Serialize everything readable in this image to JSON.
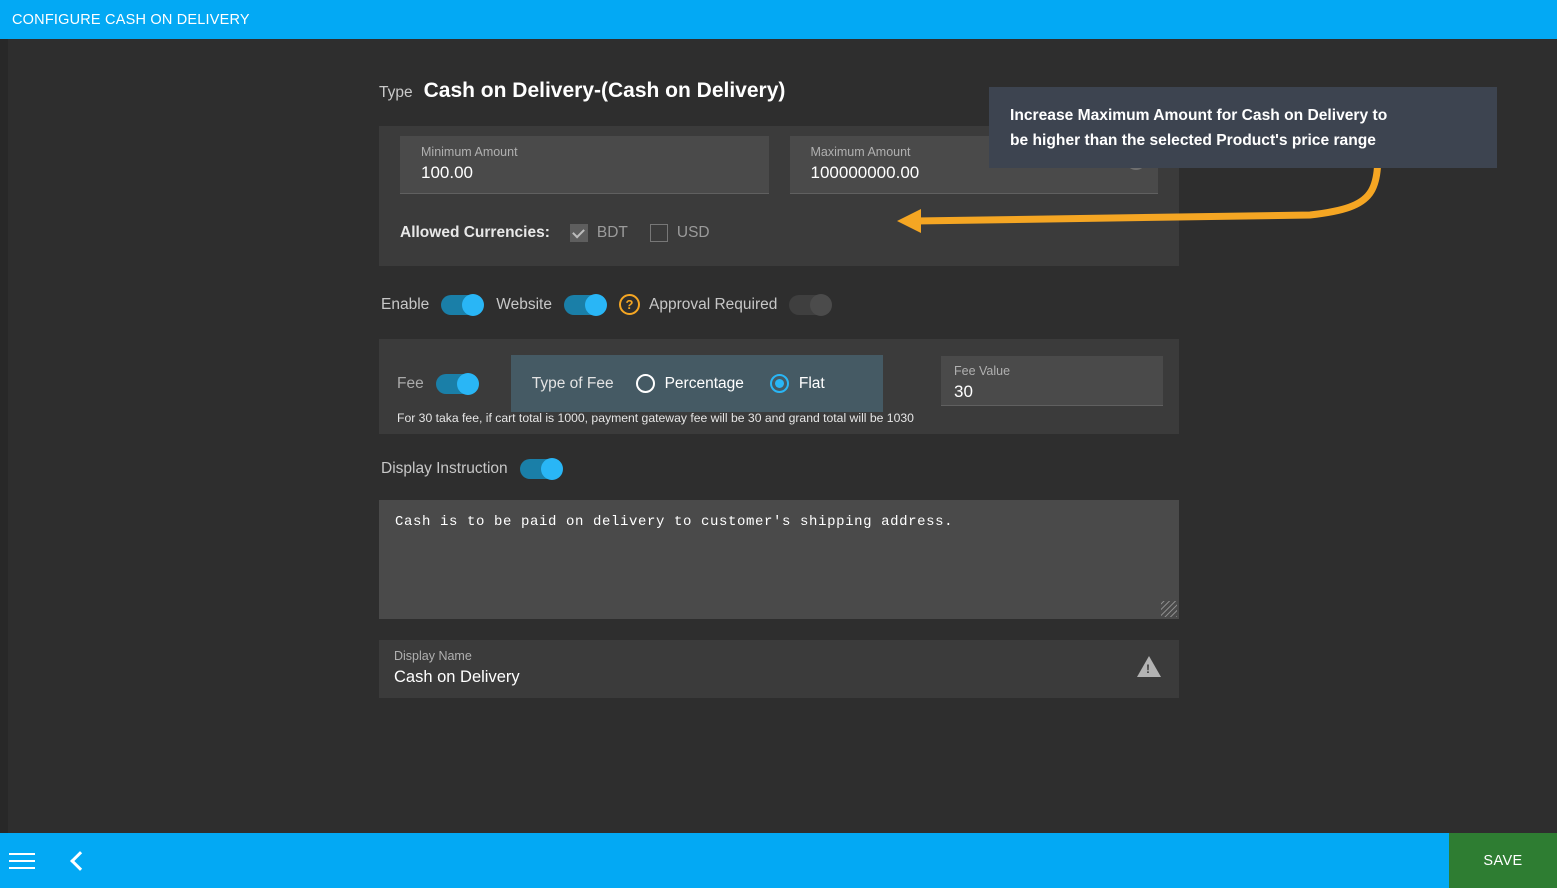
{
  "window": {
    "title": "CONFIGURE CASH ON DELIVERY"
  },
  "type_row": {
    "label": "Type",
    "value": "Cash on Delivery-(Cash on Delivery)"
  },
  "amounts": {
    "minimum": {
      "label": "Minimum Amount",
      "value": "100.00"
    },
    "maximum": {
      "label": "Maximum Amount",
      "value": "100000000.00",
      "info_icon": "info-icon"
    },
    "currencies": {
      "label": "Allowed Currencies:",
      "options": [
        {
          "code": "BDT",
          "checked": true
        },
        {
          "code": "USD",
          "checked": false
        }
      ]
    }
  },
  "toggles": [
    {
      "label": "Enable",
      "on": true
    },
    {
      "label": "Website",
      "on": true
    },
    {
      "label": "Approval Required",
      "on": false,
      "badge": "?"
    }
  ],
  "fee": {
    "label": "Fee",
    "enabled": true,
    "type_of_fee_label": "Type of Fee",
    "options": [
      {
        "label": "Percentage",
        "selected": false
      },
      {
        "label": "Flat",
        "selected": true
      }
    ],
    "value_label": "Fee Value",
    "value": "30",
    "hint": "For 30 taka fee, if cart total is 1000, payment gateway fee will be 30 and grand total will be 1030"
  },
  "instruction": {
    "toggle_label": "Display Instruction",
    "toggle_on": true,
    "text": "Cash is to be paid on delivery to customer's shipping address."
  },
  "display_name": {
    "label": "Display Name",
    "value": "Cash on Delivery",
    "warning_icon": "warning-triangle-icon"
  },
  "callout": {
    "line1": "Increase Maximum Amount for Cash on Delivery to",
    "line2": "be higher than the selected Product's price range",
    "arrow_color": "#F5A623",
    "background": "#3d4450"
  },
  "bottom_bar": {
    "menu_icon": "hamburger-menu-icon",
    "back_icon": "back-chevron-icon",
    "save_label": "SAVE",
    "save_color": "#2E7D32"
  },
  "theme": {
    "accent": "#03A9F4",
    "toggle_on": "#29B6F6",
    "panel": "#3b3b3b",
    "field": "#4a4a4a"
  }
}
